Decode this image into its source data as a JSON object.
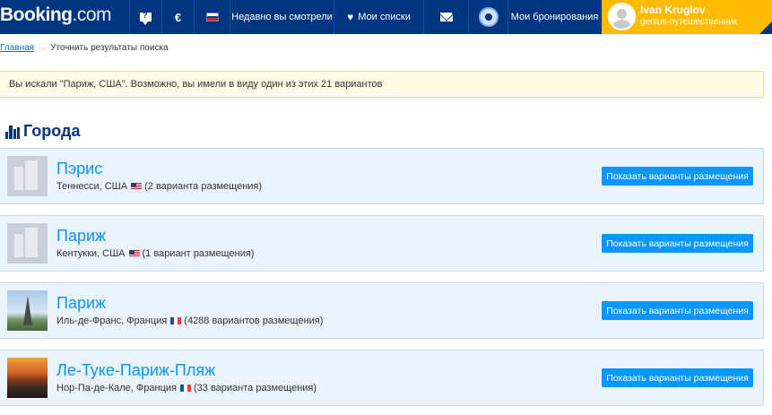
{
  "header": {
    "logo_main": "Booking",
    "logo_suffix": ".com",
    "currency": "€",
    "recent_label": "Недавно вы смотрели",
    "lists_label": "Мои списки",
    "bookings_label": "Мои бронирования",
    "user_name": "Ivan Kruglov",
    "user_status": "genius-путешественник",
    "colors": {
      "brand": "#003580",
      "genius": "#febb02"
    },
    "icons": [
      "chat-question-icon",
      "russian-flag-icon",
      "heart-icon",
      "mail-icon",
      "map-pin-icon",
      "user-avatar-icon"
    ]
  },
  "breadcrumb": {
    "home": "Главная",
    "separator": "→",
    "current": "Уточнить результаты поиска"
  },
  "notice": {
    "text": "Вы искали \"Париж, США\". Возможно, вы имели в виду один из этих 21 вариантов"
  },
  "section": {
    "title": "Города",
    "icon": "city-buildings-icon"
  },
  "results": [
    {
      "name": "Пэрис",
      "region": "Теннесси, США",
      "flag": "us-flag-icon",
      "count": "(2 варианта размещения)",
      "button": "Показать варианты размещения",
      "thumb": "building-placeholder"
    },
    {
      "name": "Париж",
      "region": "Кентукки, США",
      "flag": "us-flag-icon",
      "count": "(1 вариант размещения)",
      "button": "Показать варианты размещения",
      "thumb": "building-placeholder"
    },
    {
      "name": "Париж",
      "region": "Иль-де-Франс, Франция",
      "flag": "fr-flag-icon",
      "count": "(4288 вариантов размещения)",
      "button": "Показать варианты размещения",
      "thumb": "eiffel-tower-photo"
    },
    {
      "name": "Ле-Туке-Париж-Пляж",
      "region": "Нор-Па-де-Кале, Франция",
      "flag": "fr-flag-icon",
      "count": "(33 варианта размещения)",
      "button": "Показать варианты размещения",
      "thumb": "sunset-beach-photo"
    }
  ]
}
